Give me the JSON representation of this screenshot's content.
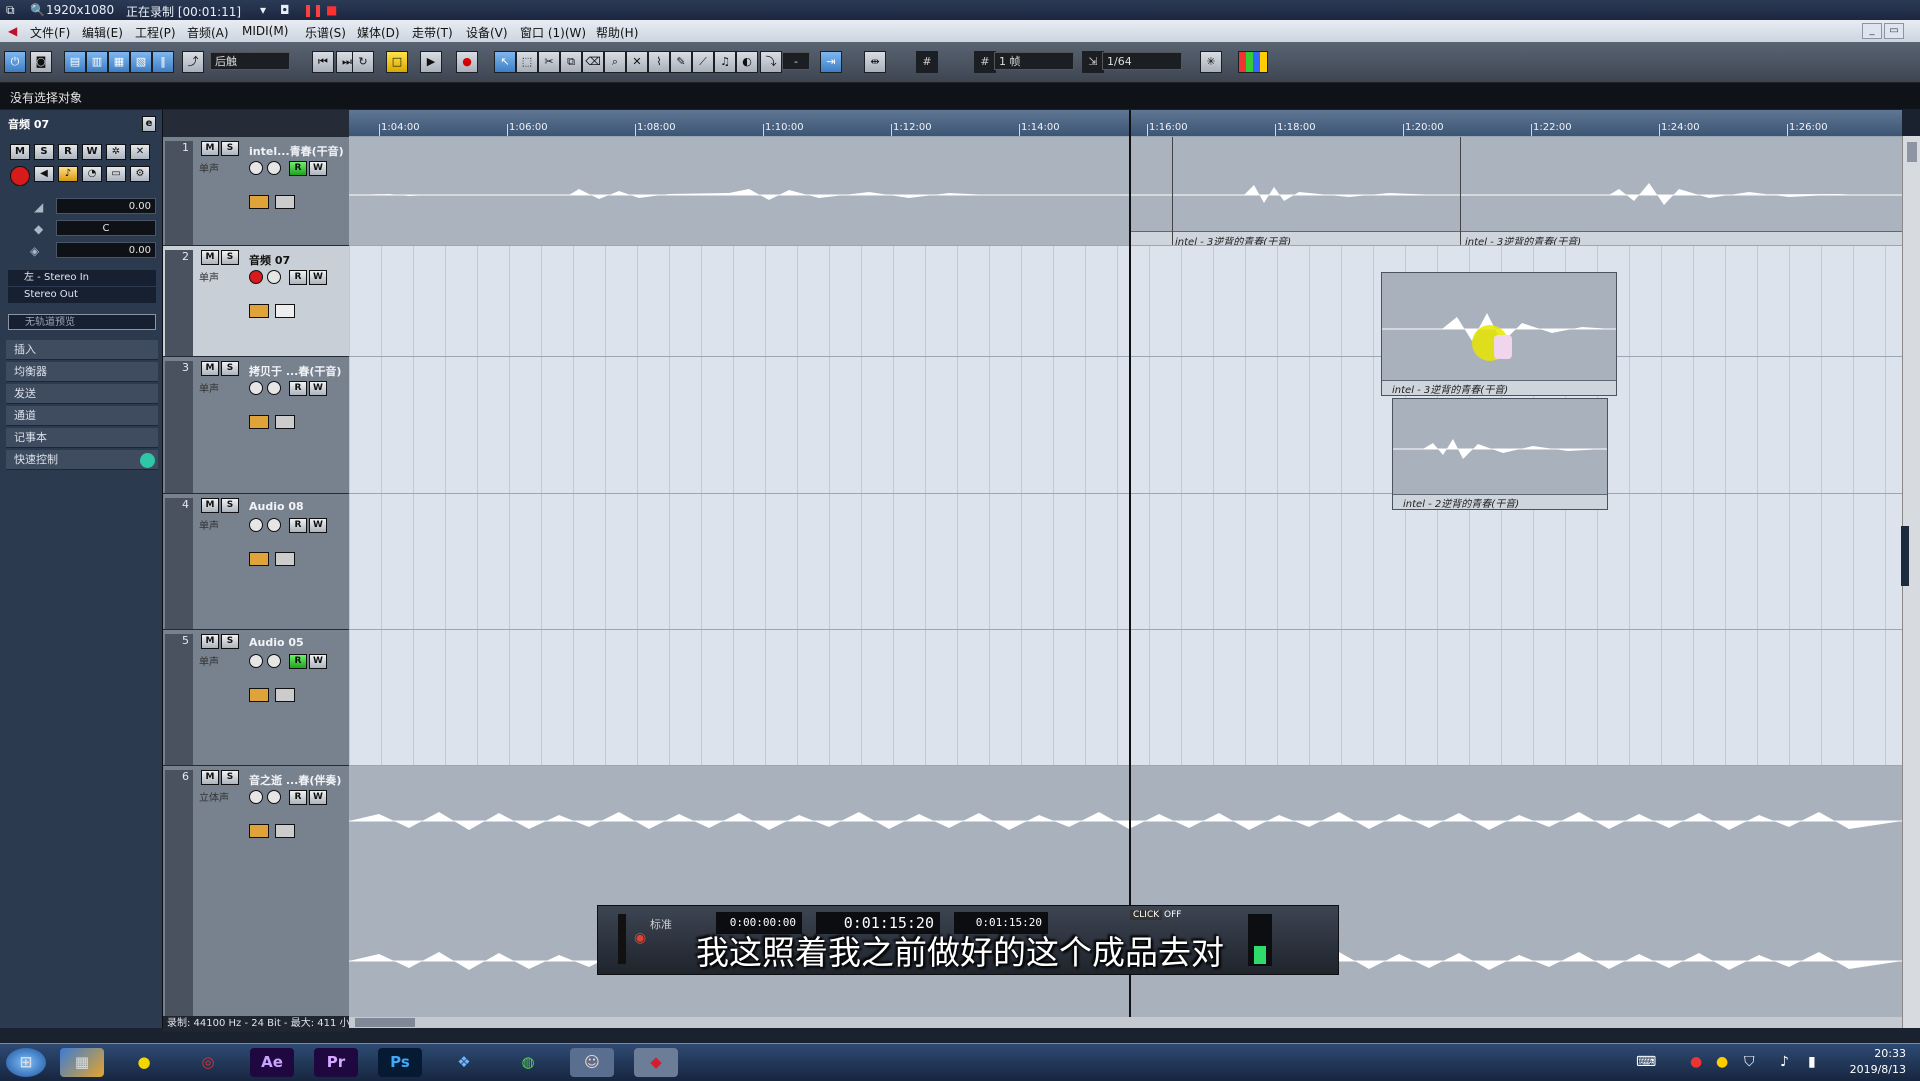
{
  "recorder": {
    "resolution": "1920x1080",
    "status": "正在录制 [00:01:11]"
  },
  "menu": [
    "文件(F)",
    "编辑(E)",
    "工程(P)",
    "音频(A)",
    "MIDI(M)",
    "乐谱(S)",
    "媒体(D)",
    "走带(T)",
    "设备(V)",
    "窗口 (1)(W)",
    "帮助(H)"
  ],
  "toolbar": {
    "automation_mode": "后触",
    "nudge": "-",
    "grid_mode": "1 帧",
    "quantize": "1/64"
  },
  "info_line": "没有选择对象",
  "inspector": {
    "title": "音频 07",
    "volume": "0.00",
    "pan": "C",
    "delay": "0.00",
    "input": "左 - Stereo In",
    "output": "Stereo Out",
    "chord": "无轨道预览",
    "sections": [
      "插入",
      "均衡器",
      "发送",
      "通道",
      "记事本",
      "快速控制"
    ]
  },
  "tracks": [
    {
      "num": "1",
      "name": "intel...青春(干音)",
      "sub": "单声"
    },
    {
      "num": "2",
      "name": "音频 07",
      "sub": "单声"
    },
    {
      "num": "3",
      "name": "拷贝于 ...春(干音)",
      "sub": "单声"
    },
    {
      "num": "4",
      "name": "Audio 08",
      "sub": "单声"
    },
    {
      "num": "5",
      "name": "Audio 05",
      "sub": "单声"
    },
    {
      "num": "6",
      "name": "音之逝 ...春(伴奏)",
      "sub": "立体声"
    }
  ],
  "ruler": [
    "1:04:00",
    "1:06:00",
    "1:08:00",
    "1:10:00",
    "1:12:00",
    "1:14:00",
    "1:16:00",
    "1:18:00",
    "1:20:00",
    "1:22:00",
    "1:24:00",
    "1:26:00"
  ],
  "clips": {
    "c1": "intel - 3逆背的青春(干音)",
    "c2": "intel - 3逆背的青春(干音)",
    "c3": "intel - 3逆背的青春(干音)",
    "c4": "intel - 2逆背的青春(干音)"
  },
  "transport": {
    "left_locator": "0:00:00:00",
    "position": "0:01:15:20",
    "right_locator": "0:01:15:20",
    "mode": "标准",
    "click": "CLICK",
    "click_state": "OFF"
  },
  "subtitle": "我这照着我之前做好的这个成品去对",
  "status": "录制: 44100 Hz - 24 Bit - 最大: 411 小时",
  "taskbar": {
    "apps": [
      "Ae",
      "Pr",
      "Ps"
    ],
    "time": "20:33",
    "date": "2019/8/13"
  }
}
